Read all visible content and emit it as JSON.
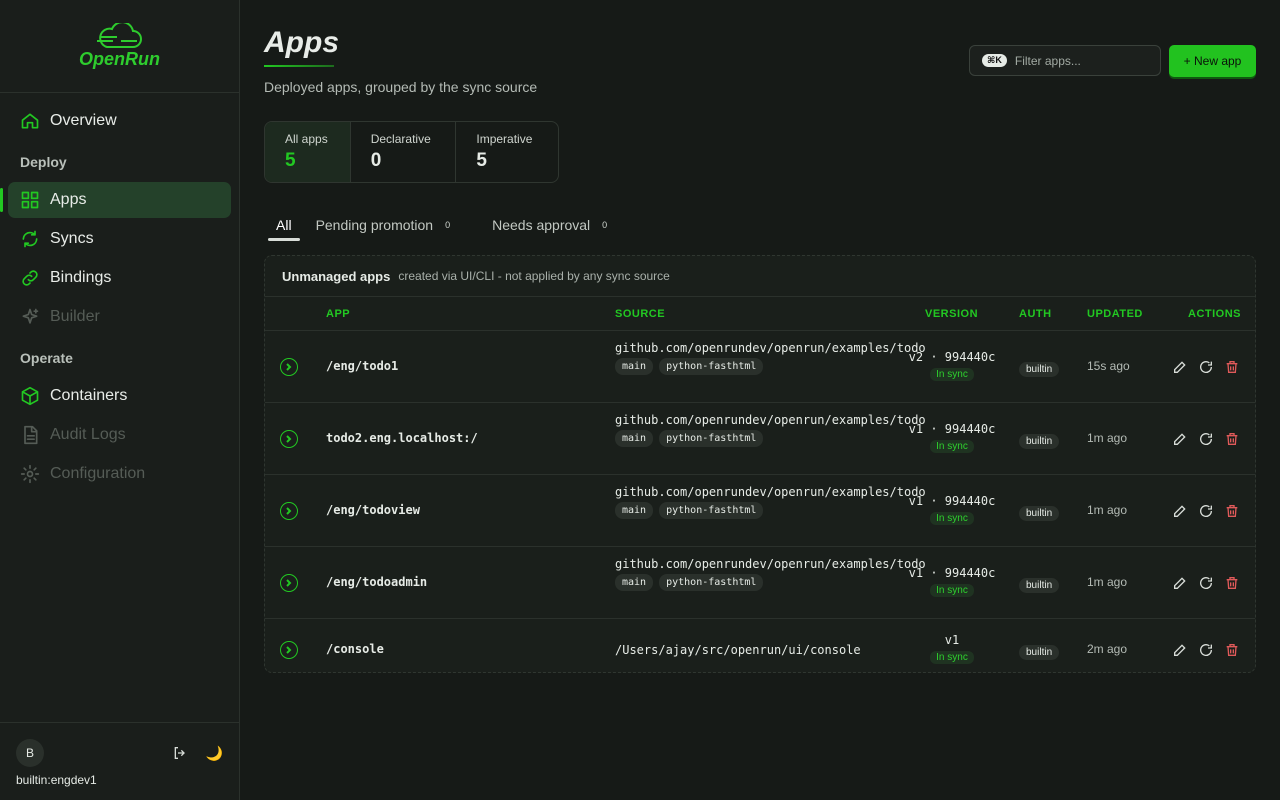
{
  "brand": {
    "name": "OpenRun"
  },
  "sidebar": {
    "items": [
      {
        "label": "Overview",
        "icon": "home-icon",
        "type": "item"
      },
      {
        "label": "Deploy",
        "type": "section"
      },
      {
        "label": "Apps",
        "icon": "grid-icon",
        "type": "item",
        "active": true
      },
      {
        "label": "Syncs",
        "icon": "refresh-icon",
        "type": "item"
      },
      {
        "label": "Bindings",
        "icon": "link-icon",
        "type": "item"
      },
      {
        "label": "Builder",
        "icon": "sparkle-icon",
        "type": "item",
        "disabled": true
      },
      {
        "label": "Operate",
        "type": "section"
      },
      {
        "label": "Containers",
        "icon": "box-icon",
        "type": "item"
      },
      {
        "label": "Audit Logs",
        "icon": "document-icon",
        "type": "item",
        "disabled": true
      },
      {
        "label": "Configuration",
        "icon": "gear-icon",
        "type": "item",
        "disabled": true
      }
    ],
    "user": {
      "initial": "B",
      "name": "builtin:engdev1"
    }
  },
  "header": {
    "title": "Apps",
    "subtitle": "Deployed apps, grouped by the sync source",
    "filter_shortcut": "⌘K",
    "filter_placeholder": "Filter apps...",
    "new_button": "+ New app"
  },
  "stats": [
    {
      "label": "All apps",
      "value": "5",
      "active": true
    },
    {
      "label": "Declarative",
      "value": "0"
    },
    {
      "label": "Imperative",
      "value": "5"
    }
  ],
  "tabs": [
    {
      "label": "All",
      "active": true,
      "count": ""
    },
    {
      "label": "Pending promotion",
      "count": "0"
    },
    {
      "label": "Needs approval",
      "count": "0"
    }
  ],
  "panel": {
    "title": "Unmanaged apps",
    "subtitle": "created via UI/CLI - not applied by any sync source",
    "columns": [
      "APP",
      "SOURCE",
      "VERSION",
      "AUTH",
      "UPDATED",
      "ACTIONS"
    ],
    "rows": [
      {
        "app": "/eng/todo1",
        "source": "github.com/openrundev/openrun/examples/todo",
        "chips": [
          "main",
          "python-fasthtml"
        ],
        "version": "v2 · 994440c",
        "status": "In sync",
        "auth": "builtin",
        "updated": "15s ago"
      },
      {
        "app": "todo2.eng.localhost:/",
        "source": "github.com/openrundev/openrun/examples/todo",
        "chips": [
          "main",
          "python-fasthtml"
        ],
        "version": "v1 · 994440c",
        "status": "In sync",
        "auth": "builtin",
        "updated": "1m ago"
      },
      {
        "app": "/eng/todoview",
        "source": "github.com/openrundev/openrun/examples/todo",
        "chips": [
          "main",
          "python-fasthtml"
        ],
        "version": "v1 · 994440c",
        "status": "In sync",
        "auth": "builtin",
        "updated": "1m ago"
      },
      {
        "app": "/eng/todoadmin",
        "source": "github.com/openrundev/openrun/examples/todo",
        "chips": [
          "main",
          "python-fasthtml"
        ],
        "version": "v1 · 994440c",
        "status": "In sync",
        "auth": "builtin",
        "updated": "1m ago"
      },
      {
        "app": "/console",
        "source": "/Users/ajay/src/openrun/ui/console",
        "chips": [],
        "version": "v1",
        "status": "In sync",
        "auth": "builtin",
        "updated": "2m ago"
      }
    ]
  },
  "colors": {
    "accent": "#22c822",
    "danger": "#e05a5a",
    "background": "#161a17"
  }
}
